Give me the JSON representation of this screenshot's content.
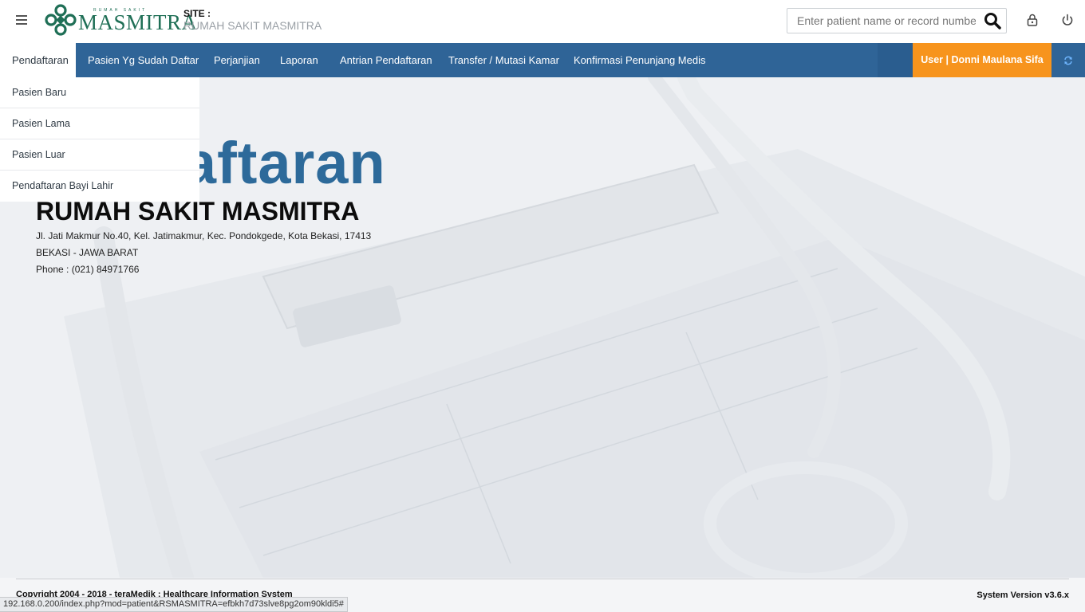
{
  "header": {
    "logo_small": "RUMAH SAKIT",
    "logo_word": "MASMITRA",
    "site_label": "SITE :",
    "site_value": "RUMAH SAKIT MASMITRA",
    "search_placeholder": "Enter patient name or record number"
  },
  "nav": {
    "items": [
      {
        "label": "Pendaftaran",
        "active": true
      },
      {
        "label": "Pasien Yg Sudah Daftar"
      },
      {
        "label": "Perjanjian"
      },
      {
        "label": "Laporan"
      },
      {
        "label": "Antrian Pendaftaran"
      },
      {
        "label": "Transfer / Mutasi Kamar"
      },
      {
        "label": "Konfirmasi Penunjang Medis"
      }
    ],
    "user_label": "User | Donni Maulana Sifa"
  },
  "dropdown": {
    "items": [
      "Pasien Baru",
      "Pasien Lama",
      "Pasien Luar",
      "Pendaftaran Bayi Lahir"
    ]
  },
  "hero": {
    "title": "Pendaftaran",
    "hospital": "RUMAH SAKIT MASMITRA",
    "address": "Jl. Jati Makmur No.40, Kel. Jatimakmur, Kec. Pondokgede, Kota Bekasi, 17413",
    "city": "BEKASI - JAWA BARAT",
    "phone": "Phone : (021) 84971766"
  },
  "footer": {
    "copyright": "Copyright 2004 - 2018 - teraMedik : Healthcare Information System",
    "version": "System Version v3.6.x",
    "status_url": "192.168.0.200/index.php?mod=patient&RSMASMITRA=efbkh7d73slve8pg2om90kldi5#"
  },
  "colors": {
    "nav_bg": "#2f6497",
    "user_bg": "#f7941d",
    "brand_green": "#1f6f56",
    "hero_title": "#2d6a9a"
  },
  "icons": {
    "menu": "hamburger-icon",
    "search": "search-icon",
    "lock": "lock-icon",
    "power": "power-icon",
    "refresh": "refresh-icon"
  }
}
